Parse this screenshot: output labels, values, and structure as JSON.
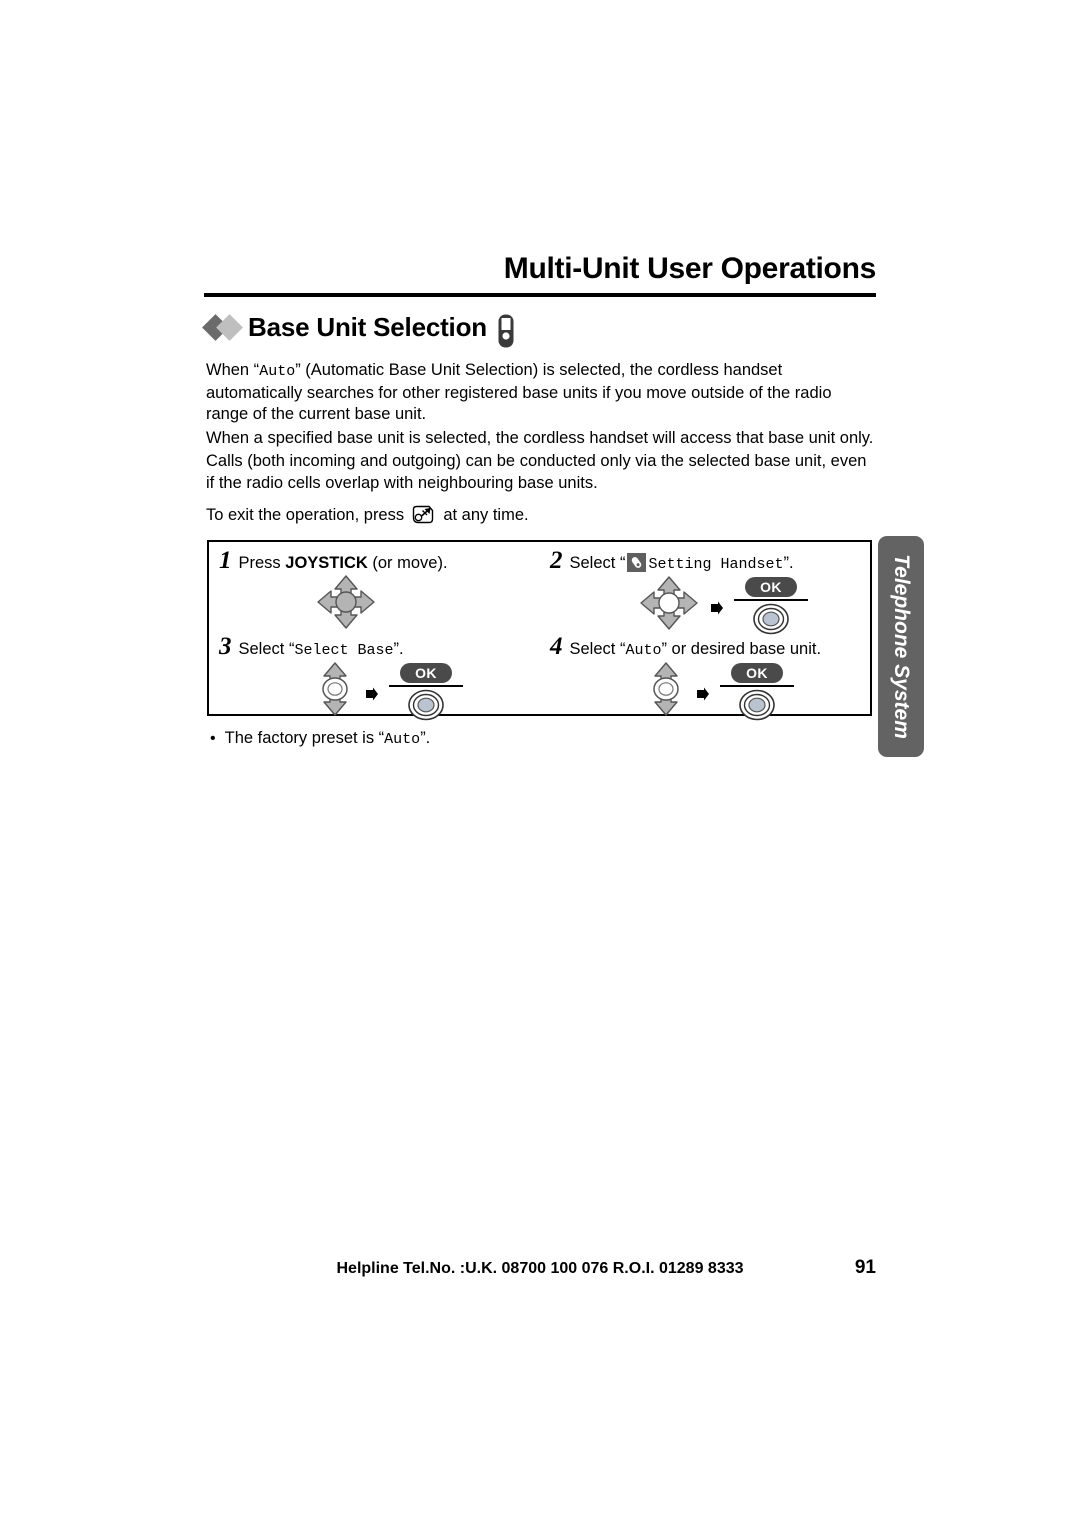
{
  "header": {
    "title": "Multi-Unit User Operations"
  },
  "section": {
    "title": "Base Unit Selection",
    "handset_icon": "handset-icon",
    "diamond_dark": "#6b6b6b",
    "diamond_light": "#bfbfbf"
  },
  "body": {
    "para1_a": "When “",
    "para1_mono": "Auto",
    "para1_b": "” (Automatic Base Unit Selection) is selected, the cordless handset automatically searches for other registered base units if you move outside of the radio range of the current base unit.",
    "para2": "When a specified base unit is selected, the cordless handset will access that base unit only.",
    "para3": "Calls (both incoming and outgoing) can be conducted only via the selected base unit, even if the radio cells overlap with neighbouring base units.",
    "para4_a": "To exit the operation, press",
    "para4_icon": "power-off-key-icon",
    "para4_b": "at any time."
  },
  "steps": [
    {
      "num": "1",
      "text_a": "Press ",
      "text_bold": "JOYSTICK",
      "text_b": " (or move).",
      "icons": [
        "joystick-4way-icon"
      ]
    },
    {
      "num": "2",
      "text_a": "Select “",
      "inline_icon": "setting-handset-icon",
      "text_mono": "Setting Handset",
      "text_b": "”.",
      "icons": [
        "joystick-4way-icon",
        "arrow-right-icon",
        "ok-button-icon"
      ],
      "ok_label": "OK"
    },
    {
      "num": "3",
      "text_a": "Select “",
      "text_mono": "Select Base",
      "text_b": "”.",
      "icons": [
        "joystick-updown-icon",
        "arrow-right-icon",
        "ok-button-icon"
      ],
      "ok_label": "OK"
    },
    {
      "num": "4",
      "text_a": "Select “",
      "text_mono": "Auto",
      "text_b": "” or desired base unit.",
      "icons": [
        "joystick-updown-icon",
        "arrow-right-icon",
        "ok-button-icon"
      ],
      "ok_label": "OK"
    }
  ],
  "note": {
    "bullet": "•",
    "text_a": "The factory preset is “",
    "text_mono": "Auto",
    "text_b": "”."
  },
  "side_tab": {
    "label": "Telephone System",
    "color": "#636363"
  },
  "footer": {
    "helpline": "Helpline Tel.No. :U.K. 08700 100 076  R.O.I. 01289 8333",
    "page_number": "91"
  }
}
